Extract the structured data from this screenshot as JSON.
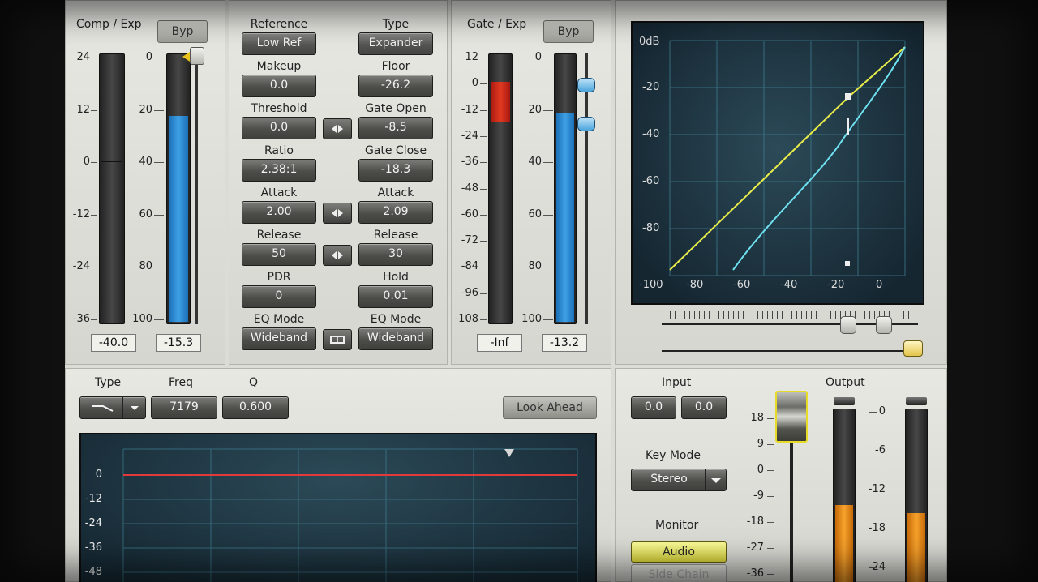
{
  "comp": {
    "title": "Comp / Exp",
    "byp_label": "Byp",
    "in_scale": [
      "24",
      "12",
      "0",
      "-12",
      "-24",
      "-36"
    ],
    "gr_scale": [
      "0",
      "20",
      "40",
      "60",
      "80",
      "100"
    ],
    "in_readout": "-40.0",
    "gr_readout": "-15.3",
    "gr_level_fraction": 0.77
  },
  "params": {
    "left": [
      {
        "label": "Reference",
        "value": "Low Ref"
      },
      {
        "label": "Makeup",
        "value": "0.0"
      },
      {
        "label": "Threshold",
        "value": "0.0"
      },
      {
        "label": "Ratio",
        "value": "2.38:1"
      },
      {
        "label": "Attack",
        "value": "2.00"
      },
      {
        "label": "Release",
        "value": "50"
      },
      {
        "label": "PDR",
        "value": "0"
      },
      {
        "label": "EQ Mode",
        "value": "Wideband"
      }
    ],
    "right": [
      {
        "label": "Type",
        "value": "Expander"
      },
      {
        "label": "Floor",
        "value": "-26.2"
      },
      {
        "label": "Gate Open",
        "value": "-8.5"
      },
      {
        "label": "Gate Close",
        "value": "-18.3"
      },
      {
        "label": "Attack",
        "value": "2.09"
      },
      {
        "label": "Release",
        "value": "30"
      },
      {
        "label": "Hold",
        "value": "0.01"
      },
      {
        "label": "EQ Mode",
        "value": "Wideband"
      }
    ]
  },
  "gate": {
    "title": "Gate / Exp",
    "byp_label": "Byp",
    "in_scale": [
      "12",
      "0",
      "-12",
      "-24",
      "-36",
      "-48",
      "-60",
      "-72",
      "-84",
      "-96",
      "-108"
    ],
    "gr_scale": [
      "0",
      "20",
      "40",
      "60",
      "80",
      "100"
    ],
    "in_readout": "-Inf",
    "gr_readout": "-13.2",
    "gr_level_fraction": 0.78
  },
  "graph": {
    "top_label": "0dB",
    "y_labels": [
      "-20",
      "-40",
      "-60",
      "-80"
    ],
    "x_labels": [
      "-100",
      "-80",
      "-60",
      "-40",
      "-20",
      "0"
    ]
  },
  "eq": {
    "type_label": "Type",
    "freq_label": "Freq",
    "q_label": "Q",
    "freq_value": "7179",
    "q_value": "0.600",
    "lookahead_label": "Look Ahead",
    "scale": [
      "0",
      "-12",
      "-24",
      "-36",
      "-48"
    ]
  },
  "io": {
    "input_label": "Input",
    "input_values": [
      "0.0",
      "0.0"
    ],
    "output_label": "Output",
    "keymode_label": "Key Mode",
    "keymode_value": "Stereo",
    "monitor_label": "Monitor",
    "monitor_audio": "Audio",
    "monitor_sidechain": "Side Chain",
    "fader_scale": [
      "18",
      "9",
      "0",
      "-9",
      "-18",
      "-27",
      "-36"
    ],
    "out_scale": [
      "0",
      "-6",
      "-12",
      "-18",
      "-24"
    ],
    "out_level_fraction": 0.48
  },
  "colors": {
    "meter_blue": "#3fa0e6",
    "meter_red": "#e23a22",
    "meter_orange": "#f7a32d",
    "curve_yellow": "#e8ec4a",
    "curve_cyan": "#6fe2f2",
    "eq_line_red": "#e23a3a",
    "graph_bg": "#223845"
  }
}
